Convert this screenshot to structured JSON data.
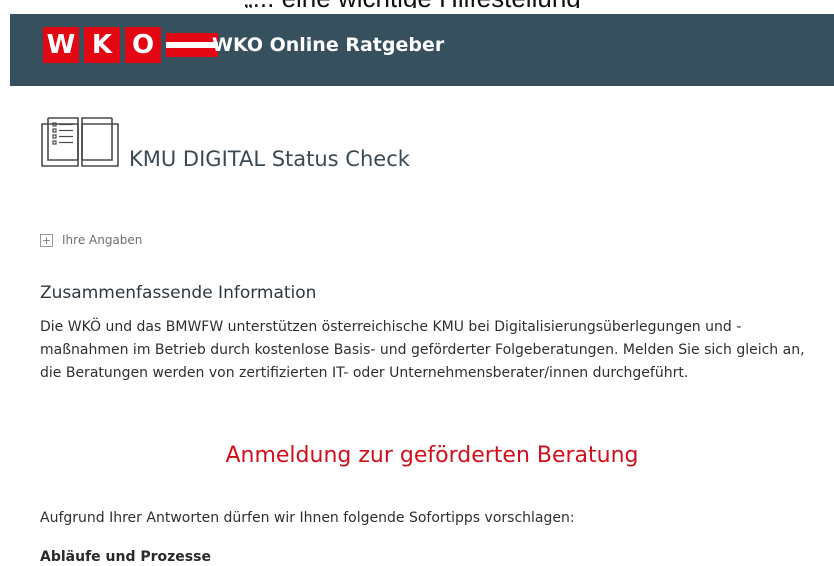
{
  "top_caption": "„... eine wichtige Hilfestellung\"",
  "header": {
    "logo_letters": [
      "W",
      "K",
      "O"
    ],
    "title": "WKO Online Ratgeber",
    "brand_color": "#e30613",
    "bar_color": "#36505e"
  },
  "page": {
    "icon": "book-icon",
    "title": "KMU DIGITAL Status Check"
  },
  "expander": {
    "icon": "plus-icon",
    "label": "Ihre Angaben"
  },
  "summary": {
    "title": "Zusammenfassende Information",
    "text": "Die WKÖ und das BMWFW unterstützen österreichische KMU bei Digitalisierungsüberlegungen und -maßnahmen im Betrieb durch kostenlose Basis- und geförderter Folgeberatungen. Melden Sie sich gleich an, die Beratungen werden von zertifizierten IT- oder Unternehmensberater/innen durchgeführt."
  },
  "cta": {
    "label": "Anmeldung zur geförderten Beratung",
    "color": "#d0101c"
  },
  "tips": {
    "intro": "Aufgrund Ihrer Antworten dürfen wir Ihnen folgende Sofortipps vorschlagen:",
    "first_section": "Abläufe und Prozesse"
  }
}
